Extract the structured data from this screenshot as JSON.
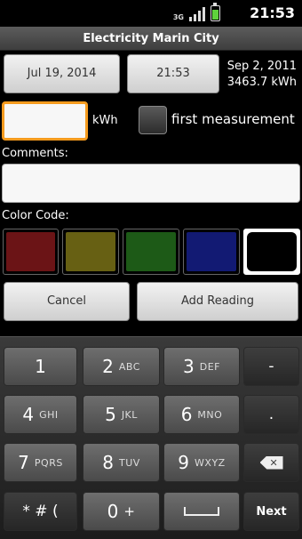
{
  "status_bar": {
    "network": "3G",
    "time": "21:53"
  },
  "title": "Electricity Marin City",
  "form": {
    "date_button": "Jul 19, 2014",
    "time_button": "21:53",
    "last_reading": {
      "date": "Sep 2, 2011",
      "value": "3463.7 kWh"
    },
    "kwh_value": "",
    "kwh_unit": "kWh",
    "first_measurement_label": "first measurement",
    "first_measurement_checked": false,
    "comments_label": "Comments:",
    "comments_value": "",
    "color_code_label": "Color Code:",
    "color_codes": [
      {
        "name": "red",
        "color": "#6b1416"
      },
      {
        "name": "olive",
        "color": "#676013"
      },
      {
        "name": "green",
        "color": "#1d5a17"
      },
      {
        "name": "blue",
        "color": "#121a73"
      },
      {
        "name": "black",
        "color": "#000000",
        "selected": true
      }
    ],
    "cancel_button": "Cancel",
    "add_button": "Add Reading"
  },
  "keyboard": {
    "keys": [
      {
        "num": "1",
        "letters": ""
      },
      {
        "num": "2",
        "letters": "ABC"
      },
      {
        "num": "3",
        "letters": "DEF"
      },
      {
        "sym": "-"
      },
      {
        "num": "4",
        "letters": "GHI"
      },
      {
        "num": "5",
        "letters": "JKL"
      },
      {
        "num": "6",
        "letters": "MNO"
      },
      {
        "sym": "."
      },
      {
        "num": "7",
        "letters": "PQRS"
      },
      {
        "num": "8",
        "letters": "TUV"
      },
      {
        "num": "9",
        "letters": "WXYZ"
      },
      {
        "icon": "backspace-icon"
      },
      {
        "sym": "* # ("
      },
      {
        "num": "0",
        "letters": "+"
      },
      {
        "icon": "space-icon"
      },
      {
        "sym": "Next"
      }
    ]
  }
}
